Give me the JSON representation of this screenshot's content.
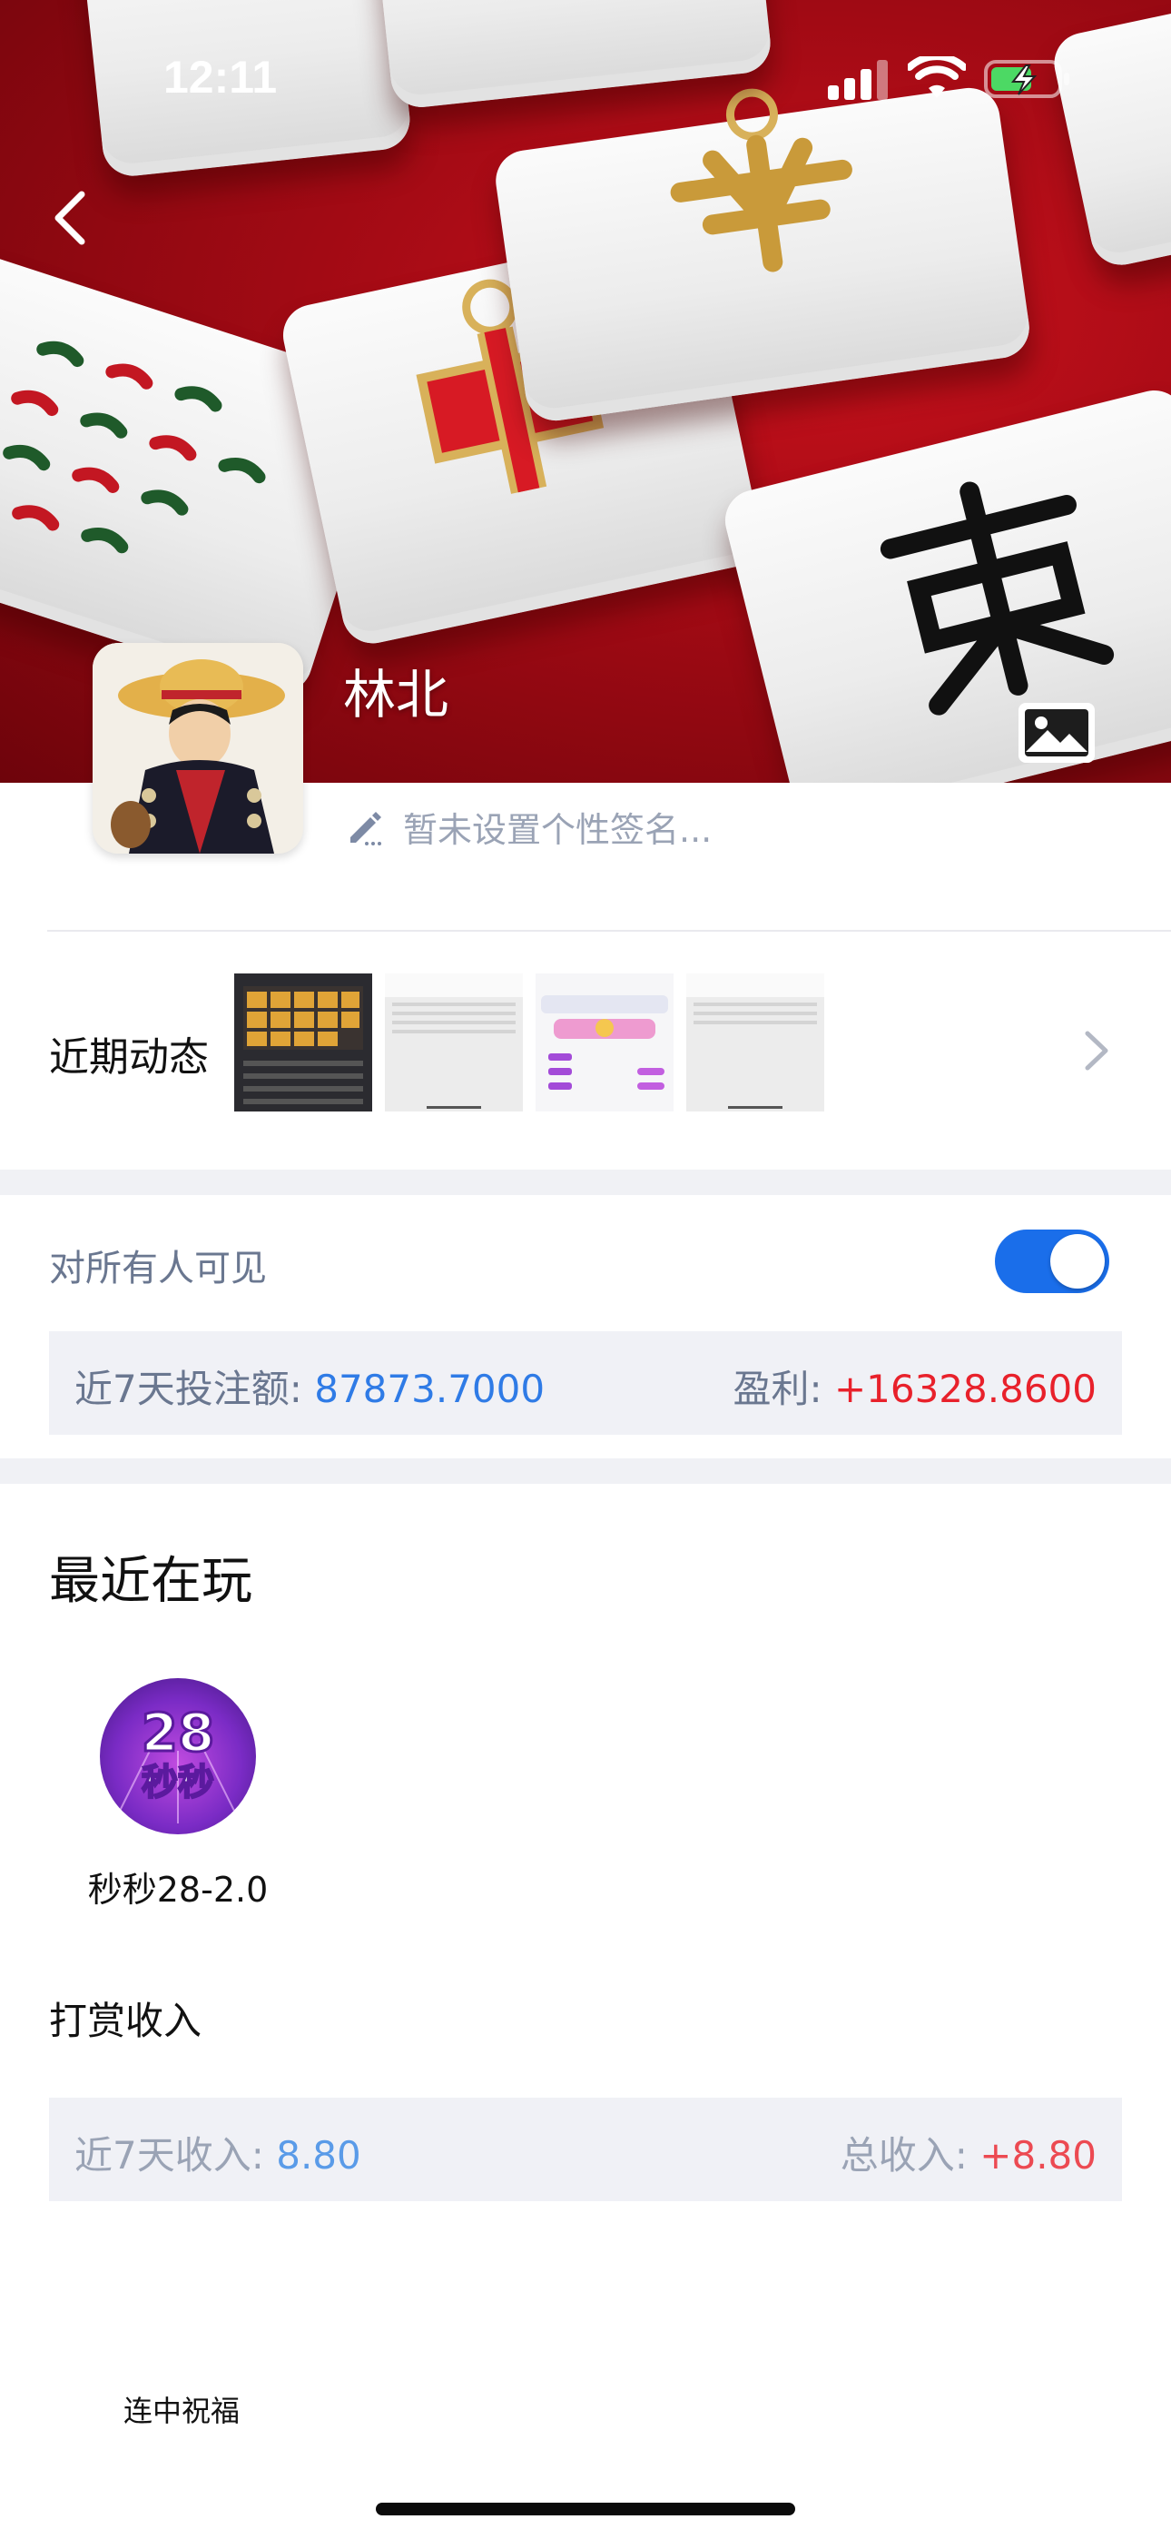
{
  "status_bar": {
    "time": "12:11"
  },
  "header": {
    "username": "林北",
    "signature_placeholder": "暂未设置个性签名..."
  },
  "recent_activity": {
    "label": "近期动态"
  },
  "visibility": {
    "label": "对所有人可见",
    "enabled": true,
    "accent_color": "#1a6eea"
  },
  "betting_stats": {
    "bet_label": "近7天投注额: ",
    "bet_value": "87873.7000",
    "profit_label": "盈利: ",
    "profit_value": "+16328.8600"
  },
  "recently_playing": {
    "title": "最近在玩",
    "games": [
      {
        "name": "秒秒28-2.0",
        "icon_text_top": "28",
        "icon_text_bottom": "秒秒"
      }
    ]
  },
  "tips": {
    "title": "打赏收入",
    "recent_label": "近7天收入: ",
    "recent_value": "8.80",
    "total_label": "总收入: ",
    "total_value": "+8.80"
  },
  "footer": {
    "gift_label": "连中祝福"
  },
  "colors": {
    "blue_value": "#2f7be6",
    "red_value": "#e8212b",
    "label_gray": "#6a7790",
    "panel_bg": "#f0f1f6"
  }
}
